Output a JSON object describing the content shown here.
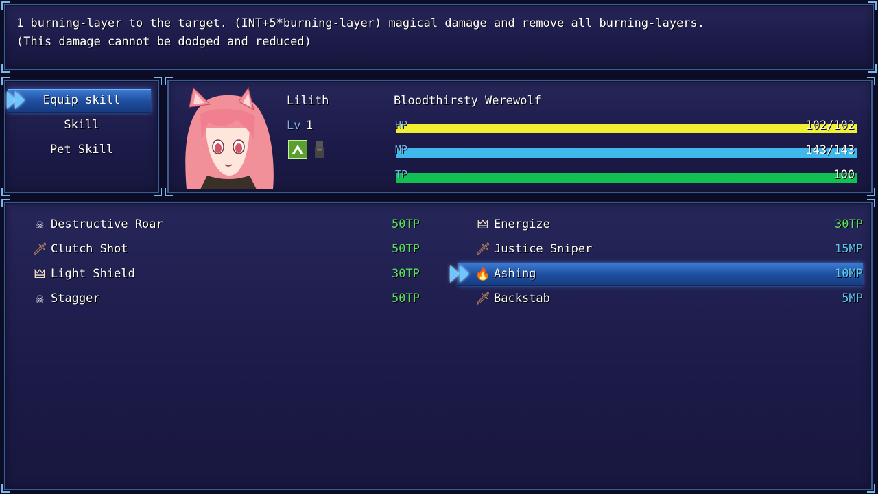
{
  "help": {
    "line1": "1 burning-layer to the target. (INT+5*burning-layer) magical damage and remove all burning-layers.",
    "line2": "(This damage cannot be dodged and reduced)"
  },
  "commands": [
    {
      "label": "Equip skill",
      "selected": true
    },
    {
      "label": "Skill",
      "selected": false
    },
    {
      "label": "Pet Skill",
      "selected": false
    }
  ],
  "actor": {
    "name": "Lilith",
    "level_label": "Lv",
    "level": "1",
    "class": "Bloodthirsty Werewolf",
    "state_icons": [
      "green-up-arrow-icon",
      "dark-figure-icon"
    ],
    "hp": {
      "label": "HP",
      "text": "102/102",
      "fraction": 1.0,
      "color": "#f0f030"
    },
    "mp": {
      "label": "MP",
      "text": "143/143",
      "fraction": 1.0,
      "color": "#40b8ec"
    },
    "tp": {
      "label": "TP",
      "text": "100",
      "fraction": 1.0,
      "color": "#10c050"
    }
  },
  "skills_left": [
    {
      "name": "Destructive Roar",
      "cost": "50TP",
      "icon": "skull-icon",
      "glyph": "☠",
      "cost_type": "tp"
    },
    {
      "name": "Clutch Shot",
      "cost": "50TP",
      "icon": "sword-icon",
      "glyph": "🗡",
      "cost_type": "tp"
    },
    {
      "name": "Light Shield",
      "cost": "30TP",
      "icon": "wings-icon",
      "glyph": "🜲",
      "cost_type": "tp"
    },
    {
      "name": "Stagger",
      "cost": "50TP",
      "icon": "skull-icon",
      "glyph": "☠",
      "cost_type": "tp"
    }
  ],
  "skills_right": [
    {
      "name": "Energize",
      "cost": "30TP",
      "icon": "wings-icon",
      "glyph": "🜲",
      "cost_type": "tp",
      "selected": false
    },
    {
      "name": "Justice Sniper",
      "cost": "15MP",
      "icon": "sword-icon",
      "glyph": "🗡",
      "cost_type": "mp",
      "selected": false
    },
    {
      "name": "Ashing",
      "cost": "10MP",
      "icon": "fire-icon",
      "glyph": "🔥",
      "cost_type": "mp",
      "selected": true
    },
    {
      "name": "Backstab",
      "cost": "5MP",
      "icon": "sword-icon",
      "glyph": "🗡",
      "cost_type": "mp",
      "selected": false
    }
  ],
  "colors": {
    "window_border": "#3e5a8e",
    "selection": "#1f4fa0",
    "tp_cost": "#5ae05a",
    "mp_cost": "#5cc8f0",
    "system_text": "#7fb2e8"
  }
}
